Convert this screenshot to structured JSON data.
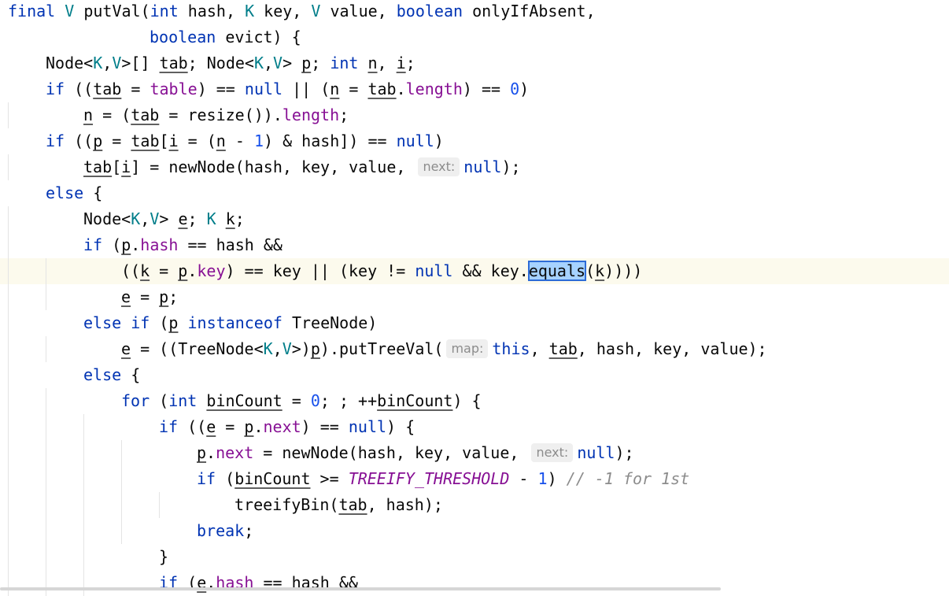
{
  "editor": {
    "language": "Java",
    "caret_line_index": 10,
    "hints": {
      "next": "next:",
      "map": "map:"
    },
    "lines": [
      "final V putVal(int hash, K key, V value, boolean onlyIfAbsent,",
      "               boolean evict) {",
      "    Node<K,V>[] tab; Node<K,V> p; int n, i;",
      "    if ((tab = table) == null || (n = tab.length) == 0)",
      "        n = (tab = resize()).length;",
      "    if ((p = tab[i = (n - 1) & hash]) == null)",
      "        tab[i] = newNode(hash, key, value, null);",
      "    else {",
      "        Node<K,V> e; K k;",
      "        if (p.hash == hash &&",
      "            ((k = p.key) == key || (key != null && key.equals(k))))",
      "            e = p;",
      "        else if (p instanceof TreeNode)",
      "            e = ((TreeNode<K,V>)p).putTreeVal(this, tab, hash, key, value);",
      "        else {",
      "            for (int binCount = 0; ; ++binCount) {",
      "                if ((e = p.next) == null) {",
      "                    p.next = newNode(hash, key, value, null);",
      "                    if (binCount >= TREEIFY_THRESHOLD - 1) // -1 for 1st",
      "                        treeifyBin(tab, hash);",
      "                    break;",
      "                }",
      "                if (e.hash == hash &&"
    ],
    "colors": {
      "keyword": "#0033b3",
      "type_param": "#007e8a",
      "field": "#871094",
      "number": "#1750eb",
      "comment": "#8c8c8c",
      "caret_row": "#fcfaed",
      "selection": "#a6d2ff"
    }
  }
}
